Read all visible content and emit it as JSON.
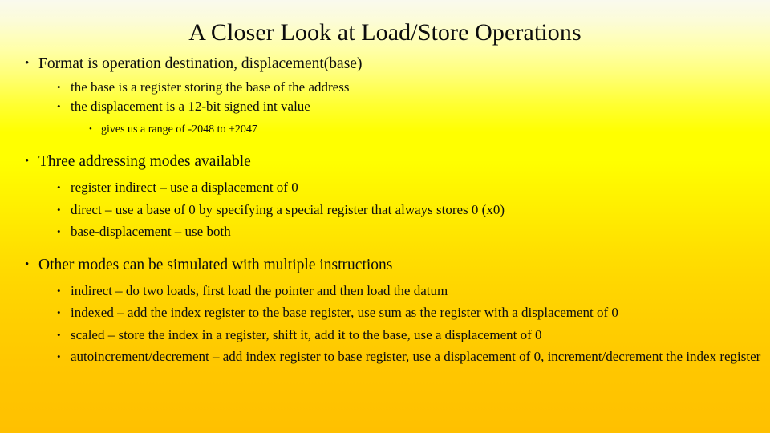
{
  "slide": {
    "title": "A Closer Look at Load/Store Operations",
    "background": {
      "top_color": "#f9f9ee",
      "mid_color": "#ffff00",
      "bottom_color": "#ffc000"
    },
    "text_color": "#0d0d0d",
    "bullet_glyph": "•",
    "groups": [
      {
        "lead": {
          "level": 1,
          "text": "Format is operation destination, displacement(base)"
        },
        "children": [
          {
            "level": 2,
            "text": "the base is a register storing the base of the address"
          },
          {
            "level": 2,
            "text": "the displacement is a 12-bit signed int value"
          },
          {
            "level": 3,
            "text": "gives us a range of -2048 to +2047"
          }
        ]
      },
      {
        "lead": {
          "level": 1,
          "text": "Three addressing modes available"
        },
        "children": [
          {
            "level": 2,
            "text": "register indirect – use a displacement of 0"
          },
          {
            "level": 2,
            "text": "direct – use a base of 0 by specifying a special register that always stores 0 (x0)"
          },
          {
            "level": 2,
            "text": "base-displacement – use both"
          }
        ]
      },
      {
        "lead": {
          "level": 1,
          "text": "Other modes can be simulated with multiple instructions"
        },
        "children": [
          {
            "level": 2,
            "text": "indirect – do two loads, first load the pointer and then load the datum"
          },
          {
            "level": 2,
            "text": "indexed – add the index register to the base register, use sum as the register with a displacement of 0"
          },
          {
            "level": 2,
            "text": "scaled – store the index in a register, shift it, add it to the base, use a displacement of 0"
          },
          {
            "level": 2,
            "text": "autoincrement/decrement – add index register to base register, use a displacement of 0, increment/decrement the index register"
          }
        ]
      }
    ]
  }
}
